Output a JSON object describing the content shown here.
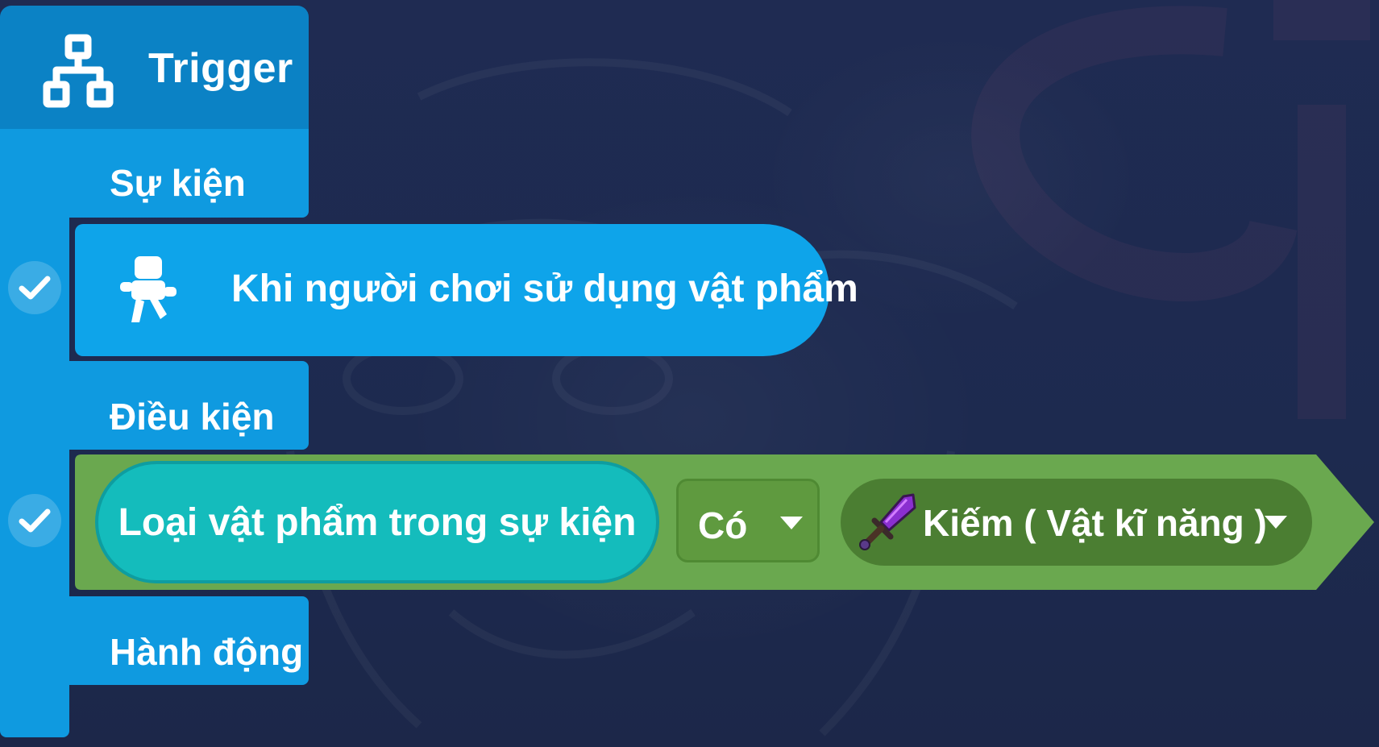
{
  "trigger": {
    "title": "Trigger",
    "icon": "hierarchy-icon"
  },
  "sections": {
    "event": "Sự kiện",
    "condition": "Điều kiện",
    "action": "Hành động"
  },
  "event_block": {
    "label": "Khi người chơi sử dụng vật phẩm",
    "icon": "player-icon",
    "enabled": true
  },
  "condition_block": {
    "subject": "Loại vật phẩm trong sự kiện",
    "operator": "Có",
    "item": "Kiếm ( Vật kĩ năng )",
    "item_icon": "sword-icon",
    "enabled": true
  },
  "colors": {
    "background": "#1f2b50",
    "rail": "#0f9ae0",
    "header": "#0b82c5",
    "event_block": "#0ea4ea",
    "condition_block": "#6aa84f",
    "subject_pill": "#14bcbc"
  }
}
